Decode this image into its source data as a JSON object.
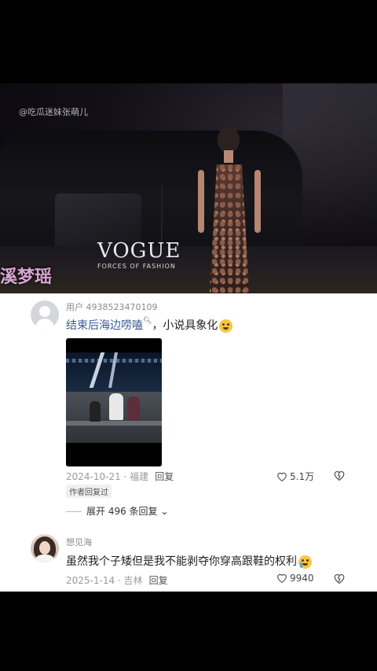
{
  "hero": {
    "watermark": "@吃瓜迷妹张萌儿",
    "brand": "VOGUE",
    "brand_sub": "FORCES OF FASHION",
    "caption": "溪梦瑶"
  },
  "comment1": {
    "username": "用户 4938523470109",
    "link_text": "结束后海边唠嗑",
    "text": "，小说具象化",
    "date_location": "2024-10-21 · 福建",
    "reply_label": "回复",
    "likes": "5.1万",
    "author_tag": "作者回复过",
    "expand": "展开 496 条回复"
  },
  "comment2": {
    "username": "想见海",
    "text": "虽然我个子矮但是我不能剥夺你穿高跟鞋的权利",
    "date_location": "2025-1-14 · 吉林",
    "reply_label": "回复",
    "likes": "9940"
  }
}
